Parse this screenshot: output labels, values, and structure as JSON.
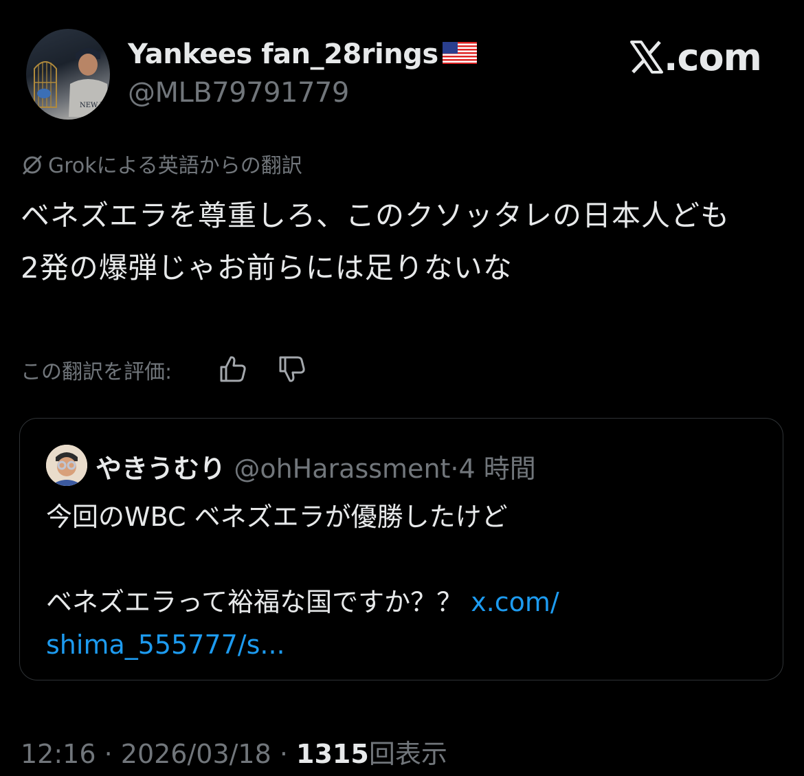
{
  "author": {
    "display_name": "Yankees fan_28rings",
    "flag_icon": "us-flag-emoji",
    "handle": "@MLB79791779"
  },
  "brand": {
    "label": ".com",
    "icon": "x-logo"
  },
  "translation": {
    "label": "Grokによる英語からの翻訳"
  },
  "post": {
    "text": "ベネズエラを尊重しろ、このクソッタレの日本人ども\n2発の爆弾じゃお前らには足りないな"
  },
  "rating": {
    "label": "この翻訳を評価:"
  },
  "quote": {
    "display_name": "やきうむり",
    "handle": "@ohHarassment",
    "separator": "·",
    "time": "4 時間",
    "text_line1": "今回のWBC ベネズエラが優勝したけど",
    "text_line2": "ベネズエラって裕福な国ですか？？ ",
    "link_part1": "x.com/",
    "link_part2": "shima_555777/s..."
  },
  "footer": {
    "time": "12:16",
    "sep1": " · ",
    "date": "2026/03/18",
    "sep2": " · ",
    "views_count": "1315",
    "views_label": "回表示"
  },
  "colors": {
    "background": "#000000",
    "text": "#e7e9ea",
    "muted": "#71767b",
    "link": "#1d9bf0",
    "border": "#2f3336"
  }
}
